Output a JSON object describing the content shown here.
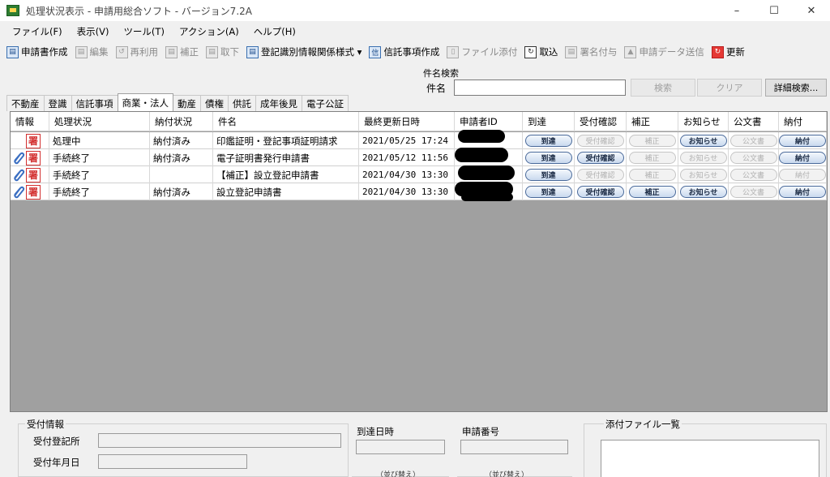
{
  "window": {
    "title": "処理状況表示 - 申請用総合ソフト - バージョン7.2A",
    "controls": {
      "minimize": "–",
      "maximize": "☐",
      "close": "✕"
    }
  },
  "menu": {
    "items": [
      "ファイル(F)",
      "表示(V)",
      "ツール(T)",
      "アクション(A)",
      "ヘルプ(H)"
    ]
  },
  "toolbar": {
    "items": [
      {
        "label": "申請書作成",
        "icon": "document-create-icon",
        "glyph": "▤",
        "enabled": true
      },
      {
        "label": "編集",
        "icon": "edit-icon",
        "glyph": "▤",
        "enabled": false
      },
      {
        "label": "再利用",
        "icon": "reuse-icon",
        "glyph": "↺",
        "enabled": false
      },
      {
        "label": "補正",
        "icon": "amend-icon",
        "glyph": "▤",
        "enabled": false
      },
      {
        "label": "取下",
        "icon": "withdraw-icon",
        "glyph": "▤",
        "enabled": false
      },
      {
        "label": "登記識別情報関係様式 ▾",
        "icon": "registration-form-icon",
        "glyph": "▤",
        "enabled": true
      },
      {
        "label": "信託事項作成",
        "icon": "trust-create-icon",
        "glyph": "信",
        "enabled": true
      },
      {
        "label": "ファイル添付",
        "icon": "attach-file-icon",
        "glyph": "▯",
        "enabled": false
      },
      {
        "label": "取込",
        "icon": "import-icon",
        "glyph": "↻",
        "enabled": true,
        "style": "dark"
      },
      {
        "label": "署名付与",
        "icon": "sign-icon",
        "glyph": "▤",
        "enabled": false
      },
      {
        "label": "申請データ送信",
        "icon": "send-data-icon",
        "glyph": "▲",
        "enabled": false
      },
      {
        "label": "更新",
        "icon": "refresh-icon",
        "glyph": "↻",
        "enabled": true,
        "style": "red"
      }
    ]
  },
  "search": {
    "legend": "件名検索",
    "label": "件名",
    "value": "",
    "search_button": "検索",
    "clear_button": "クリア",
    "advanced_button": "詳細検索..."
  },
  "tabs": [
    {
      "label": "不動産",
      "active": false
    },
    {
      "label": "登識",
      "active": false
    },
    {
      "label": "信託事項",
      "active": false
    },
    {
      "label": "商業・法人",
      "active": true
    },
    {
      "label": "動産",
      "active": false
    },
    {
      "label": "債権",
      "active": false
    },
    {
      "label": "供託",
      "active": false
    },
    {
      "label": "成年後見",
      "active": false
    },
    {
      "label": "電子公証",
      "active": false
    }
  ],
  "grid": {
    "columns": [
      "情報",
      "処理状況",
      "納付状況",
      "件名",
      "最終更新日時",
      "申請者ID",
      "到達",
      "受付確認",
      "補正",
      "お知らせ",
      "公文書",
      "納付"
    ],
    "sorted_column": "最終更新日時",
    "rows": [
      {
        "has_attachment": false,
        "sign_glyph": "署",
        "status": "処理中",
        "payment": "納付済み",
        "subject": "印鑑証明・登記事項証明請求",
        "updated": "2021/05/25 17:24",
        "applicant_id": "",
        "buttons": [
          {
            "label": "到達",
            "enabled": true
          },
          {
            "label": "受付確認",
            "enabled": false
          },
          {
            "label": "補正",
            "enabled": false
          },
          {
            "label": "お知らせ",
            "enabled": true
          },
          {
            "label": "公文書",
            "enabled": false
          },
          {
            "label": "納付",
            "enabled": true
          }
        ]
      },
      {
        "has_attachment": true,
        "sign_glyph": "署",
        "status": "手続終了",
        "payment": "納付済み",
        "subject": "電子証明書発行申請書",
        "updated": "2021/05/12 11:56",
        "applicant_id": "",
        "buttons": [
          {
            "label": "到達",
            "enabled": true
          },
          {
            "label": "受付確認",
            "enabled": true
          },
          {
            "label": "補正",
            "enabled": false
          },
          {
            "label": "お知らせ",
            "enabled": false
          },
          {
            "label": "公文書",
            "enabled": false
          },
          {
            "label": "納付",
            "enabled": true
          }
        ]
      },
      {
        "has_attachment": true,
        "sign_glyph": "署",
        "status": "手続終了",
        "payment": "",
        "subject": "【補正】設立登記申請書",
        "updated": "2021/04/30 13:30",
        "applicant_id": "",
        "buttons": [
          {
            "label": "到達",
            "enabled": true
          },
          {
            "label": "受付確認",
            "enabled": false
          },
          {
            "label": "補正",
            "enabled": false
          },
          {
            "label": "お知らせ",
            "enabled": false
          },
          {
            "label": "公文書",
            "enabled": false
          },
          {
            "label": "納付",
            "enabled": false
          }
        ]
      },
      {
        "has_attachment": true,
        "sign_glyph": "署",
        "status": "手続終了",
        "payment": "納付済み",
        "subject": "設立登記申請書",
        "updated": "2021/04/30 13:30",
        "applicant_id": "",
        "buttons": [
          {
            "label": "到達",
            "enabled": true
          },
          {
            "label": "受付確認",
            "enabled": true
          },
          {
            "label": "補正",
            "enabled": true
          },
          {
            "label": "お知らせ",
            "enabled": true
          },
          {
            "label": "公文書",
            "enabled": false
          },
          {
            "label": "納付",
            "enabled": true
          }
        ]
      }
    ]
  },
  "bottom": {
    "receipt_info_legend": "受付情報",
    "registry_office_label": "受付登記所",
    "registry_office_value": "",
    "receipt_date_label": "受付年月日",
    "receipt_date_value": "",
    "arrival_legend": "到達日時",
    "arrival_value": "",
    "arrival_note": "（並び替え）",
    "application_no_legend": "申請番号",
    "application_no_value": "",
    "application_no_note": "（並び替え）",
    "attachments_legend": "添付ファイル一覧"
  },
  "colors": {
    "grid_background": "#a0a0a0",
    "sign_red": "#d32f2f",
    "button_border": "#4a6a9a",
    "refresh_red": "#e53935"
  }
}
